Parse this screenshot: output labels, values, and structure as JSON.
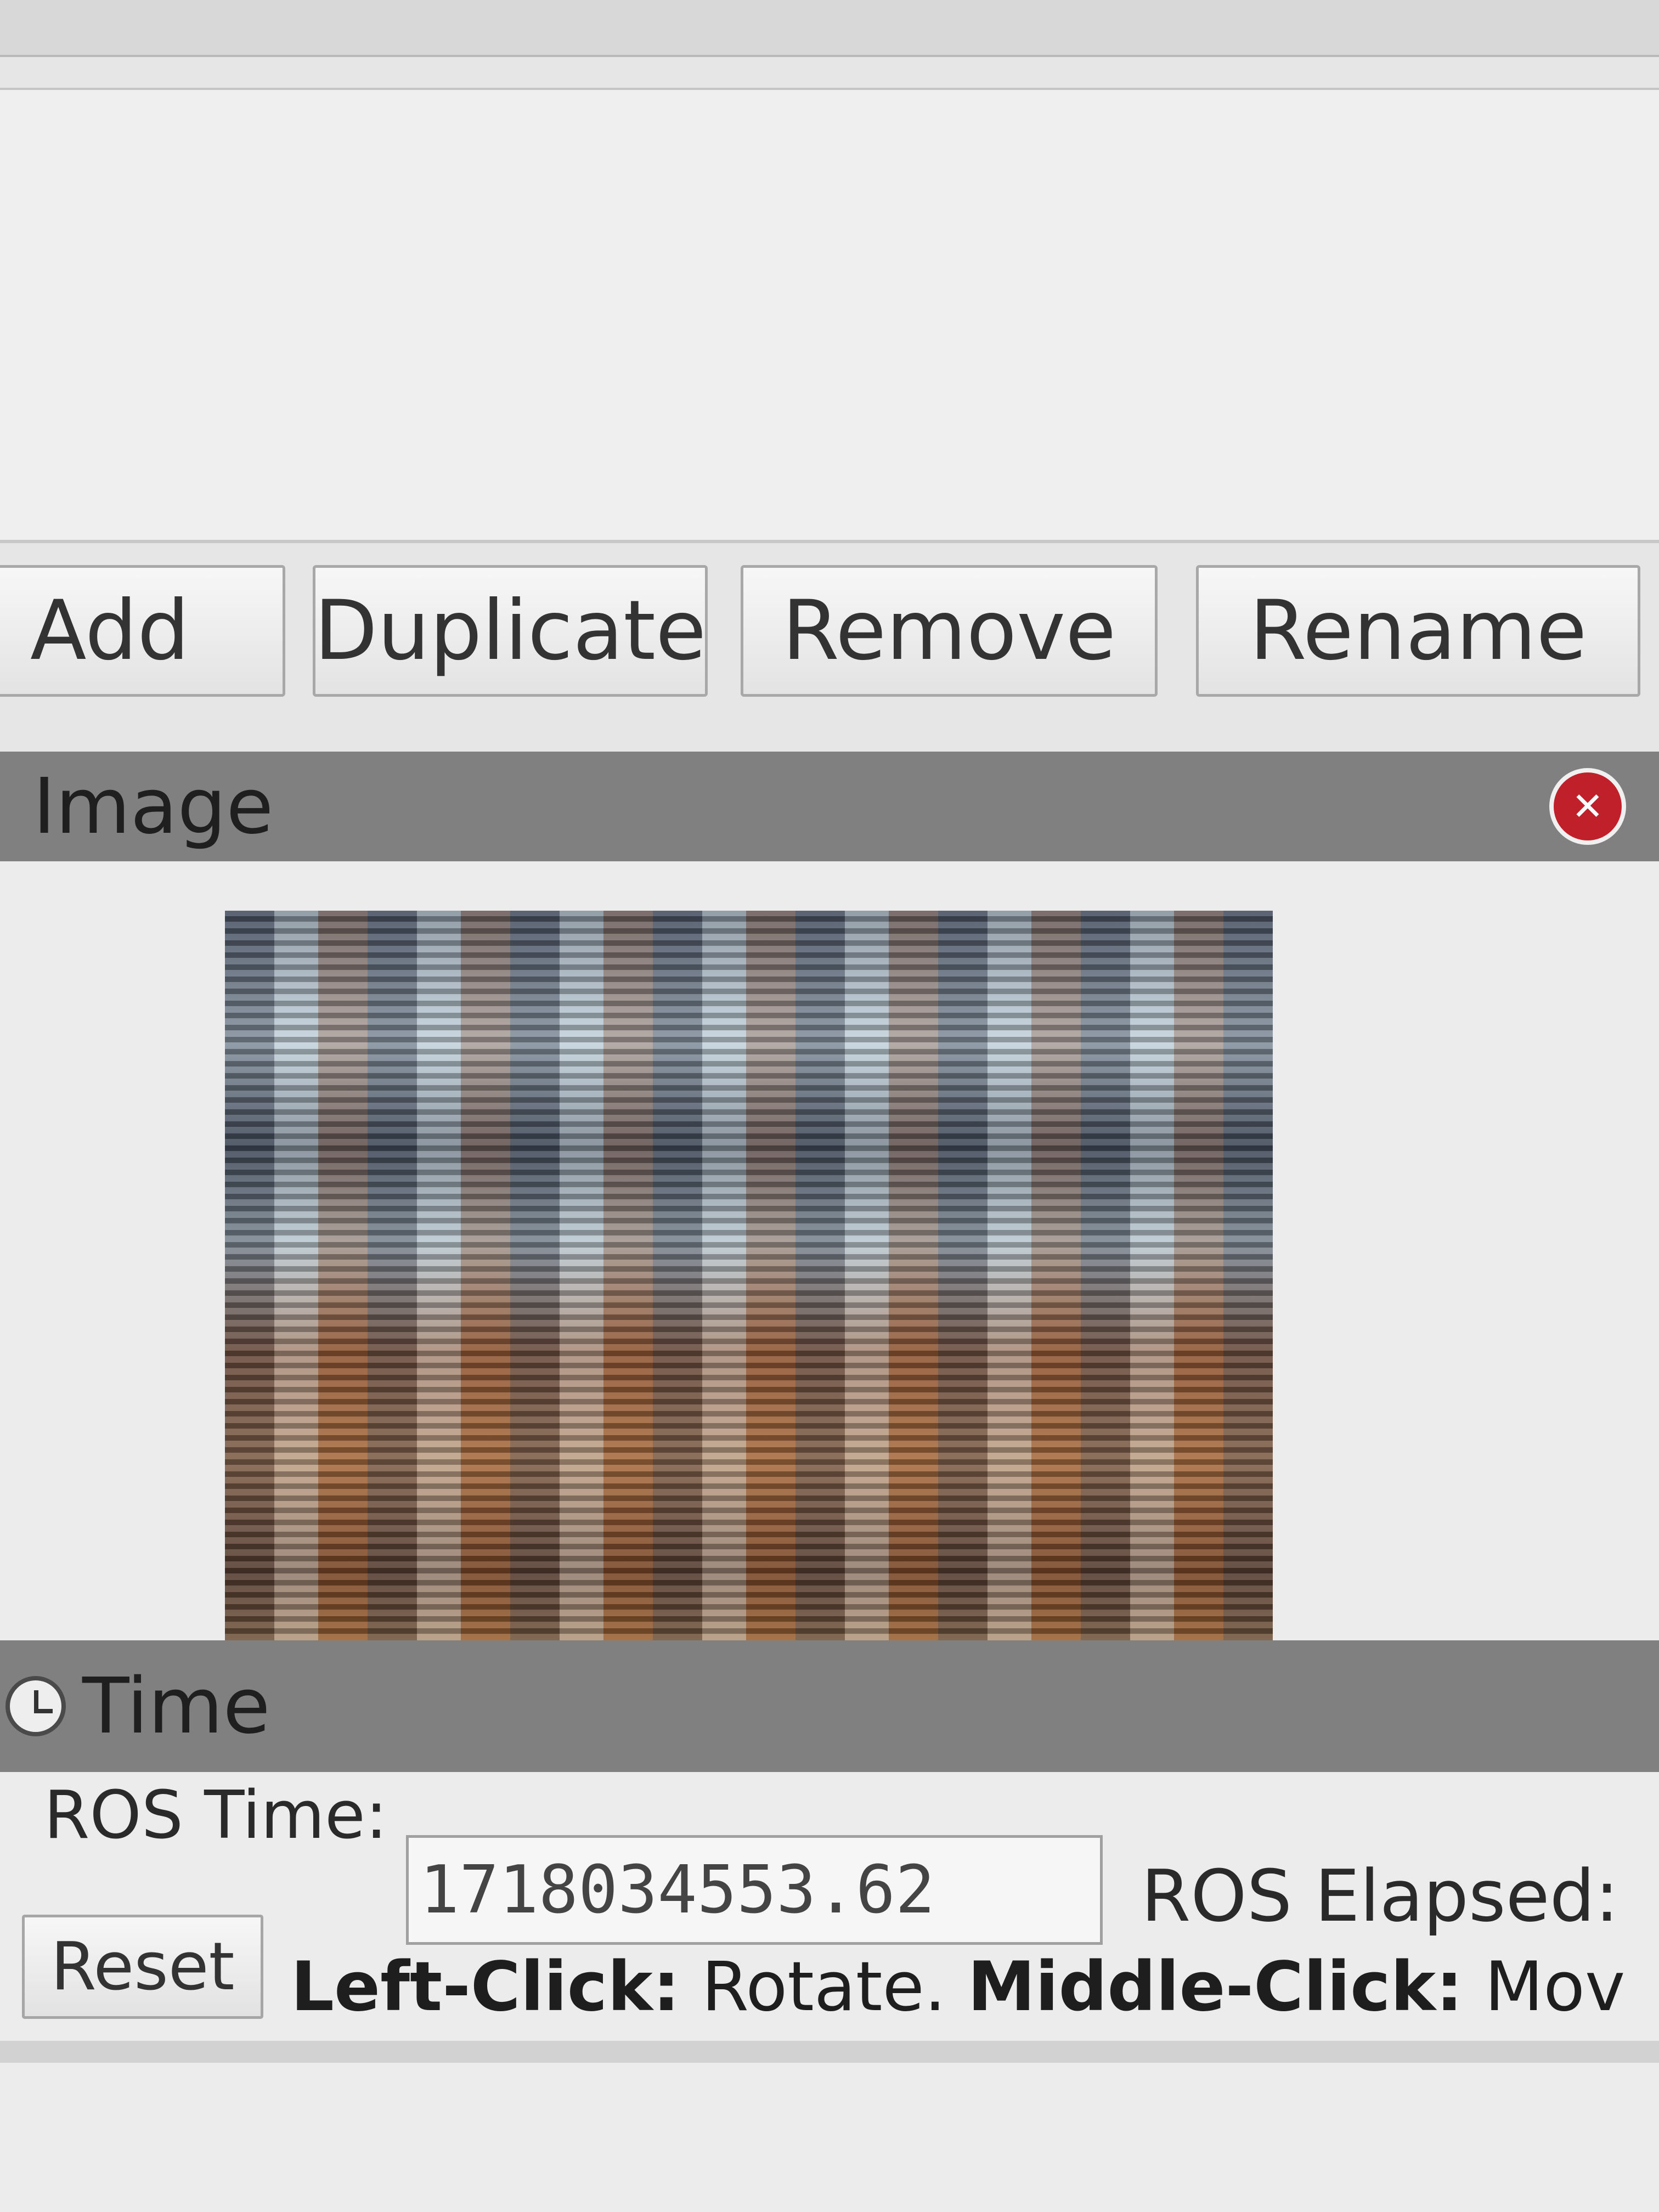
{
  "toolbar": {
    "add_label": "Add",
    "duplicate_label": "Duplicate",
    "remove_label": "Remove",
    "rename_label": "Rename"
  },
  "image_panel": {
    "title": "Image",
    "close_icon": "close-icon"
  },
  "time_panel": {
    "title": "Time",
    "icon": "clock-icon",
    "ros_time_label": "ROS Time:",
    "ros_time_value": "1718034553.62",
    "ros_elapsed_label": "ROS Elapsed:"
  },
  "status": {
    "reset_label": "Reset",
    "left_click_key": "Left-Click:",
    "left_click_action": "Rotate.",
    "middle_click_key": "Middle-Click:",
    "middle_click_action": "Mov"
  },
  "colors": {
    "panel_header": "#808080",
    "close_button": "#c0202a"
  }
}
